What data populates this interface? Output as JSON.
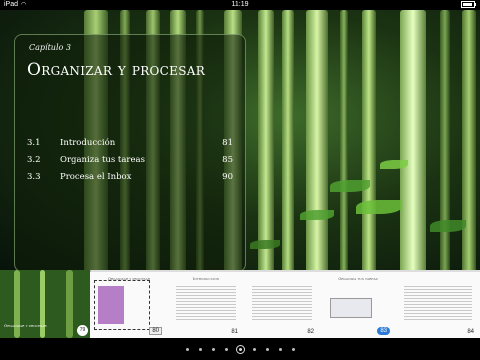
{
  "status_bar": {
    "device": "iPad",
    "time": "11:19"
  },
  "chapter": {
    "label": "Capítulo 3",
    "title": "Organizar y procesar",
    "toc": [
      {
        "num": "3.1",
        "label": "Introducción",
        "page": "81"
      },
      {
        "num": "3.2",
        "label": "Organiza tus tareas",
        "page": "85"
      },
      {
        "num": "3.3",
        "label": "Procesa el Inbox",
        "page": "90"
      }
    ]
  },
  "thumbnails": [
    {
      "title": "Organizar y procesar",
      "page": "79"
    },
    {
      "title": "Organizar y procesar",
      "page": "80"
    },
    {
      "title": "Introducción",
      "page": "81"
    },
    {
      "title": "",
      "page": "82"
    },
    {
      "title": "Organiza tus tareas",
      "page": "83"
    },
    {
      "title": "",
      "page": "84"
    }
  ],
  "pager": {
    "dot_count": 9,
    "current_index": 4
  },
  "colors": {
    "accent": "#2c7ad8",
    "panel_border": "#a0c88c"
  }
}
